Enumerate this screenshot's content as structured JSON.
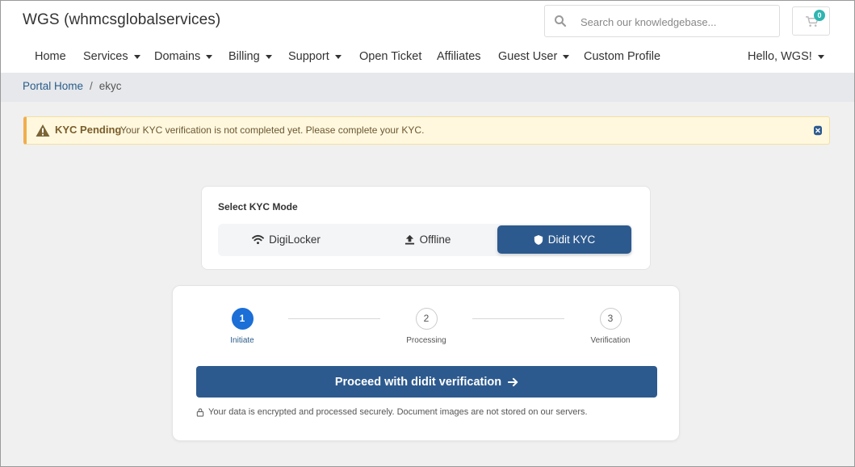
{
  "header": {
    "brand": "WGS (whmcsglobalservices)",
    "search_placeholder": "Search our knowledgebase...",
    "cart_count": "0"
  },
  "nav": {
    "items": [
      {
        "label": "Home"
      },
      {
        "label": "Services"
      },
      {
        "label": "Domains"
      },
      {
        "label": "Billing"
      },
      {
        "label": "Support"
      },
      {
        "label": "Open Ticket"
      },
      {
        "label": "Affiliates"
      },
      {
        "label": "Guest User"
      },
      {
        "label": "Custom Profile"
      }
    ],
    "user_menu": "Hello, WGS!"
  },
  "breadcrumb": {
    "home": "Portal Home",
    "separator": "/",
    "current": "ekyc"
  },
  "alert": {
    "title": "KYC Pending",
    "message": "Your KYC verification is not completed yet. Please complete your KYC."
  },
  "kyc_mode": {
    "title": "Select KYC Mode",
    "tabs": [
      {
        "label": "DigiLocker",
        "icon": "wifi-icon"
      },
      {
        "label": "Offline",
        "icon": "upload-icon"
      },
      {
        "label": "Didit KYC",
        "icon": "shield-icon",
        "active": true
      }
    ]
  },
  "verification": {
    "steps": [
      {
        "number": "1",
        "label": "Initiate",
        "active": true
      },
      {
        "number": "2",
        "label": "Processing"
      },
      {
        "number": "3",
        "label": "Verification"
      }
    ],
    "button_label": "Proceed with didit verification",
    "secure_note": "Your data is encrypted and processed securely. Document images are not stored on our servers."
  },
  "colors": {
    "primary": "#2d5a8e",
    "step_active": "#1b6fd6",
    "badge": "#2fb5b1",
    "alert_bg": "#fff8df",
    "alert_border": "#f0ad4e"
  }
}
